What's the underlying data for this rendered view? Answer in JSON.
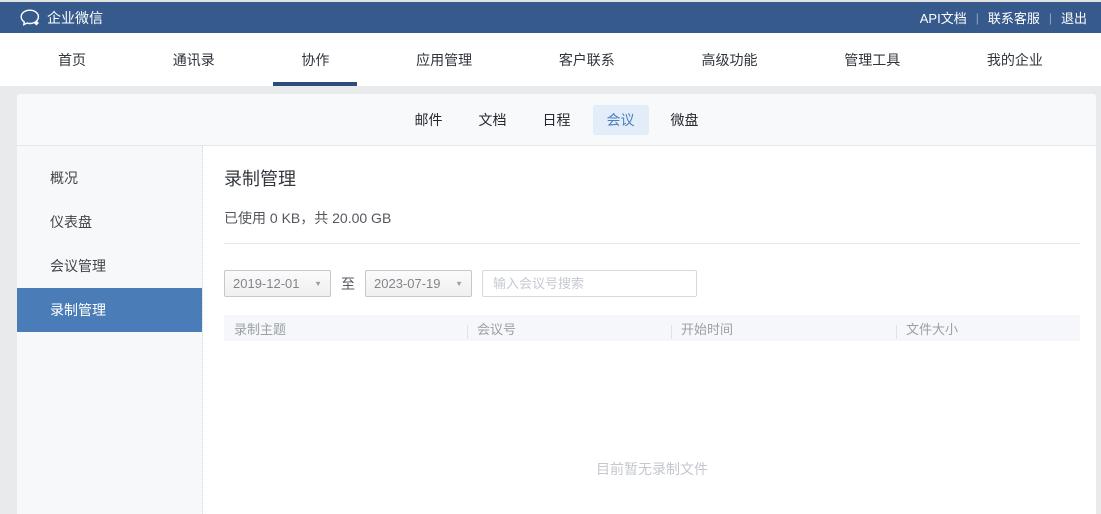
{
  "topbar": {
    "brand": "企业微信",
    "links": [
      {
        "label": "API文档"
      },
      {
        "label": "联系客服"
      },
      {
        "label": "退出"
      }
    ],
    "separator": "|"
  },
  "navbar": {
    "items": [
      {
        "label": "首页",
        "active": false
      },
      {
        "label": "通讯录",
        "active": false
      },
      {
        "label": "协作",
        "active": true
      },
      {
        "label": "应用管理",
        "active": false
      },
      {
        "label": "客户联系",
        "active": false
      },
      {
        "label": "高级功能",
        "active": false
      },
      {
        "label": "管理工具",
        "active": false
      },
      {
        "label": "我的企业",
        "active": false
      }
    ]
  },
  "subnav": {
    "tabs": [
      {
        "label": "邮件",
        "active": false
      },
      {
        "label": "文档",
        "active": false
      },
      {
        "label": "日程",
        "active": false
      },
      {
        "label": "会议",
        "active": true
      },
      {
        "label": "微盘",
        "active": false
      }
    ]
  },
  "sidebar": {
    "items": [
      {
        "label": "概况",
        "active": false
      },
      {
        "label": "仪表盘",
        "active": false
      },
      {
        "label": "会议管理",
        "active": false
      },
      {
        "label": "录制管理",
        "active": true
      }
    ]
  },
  "main": {
    "title": "录制管理",
    "usage": "已使用 0 KB，共 20.00 GB",
    "filters": {
      "start_date": "2019-12-01",
      "range_separator": "至",
      "end_date": "2023-07-19",
      "search_placeholder": "输入会议号搜索"
    },
    "table": {
      "columns": [
        "录制主题",
        "会议号",
        "开始时间",
        "文件大小"
      ],
      "rows": []
    },
    "empty_text": "目前暂无录制文件"
  },
  "colors": {
    "brand": "#375a8c",
    "nav-active": "#2d4d78",
    "accent": "#4b7ec0",
    "tab-active-bg": "#e2edf9",
    "side-active": "#4a7cb8"
  }
}
